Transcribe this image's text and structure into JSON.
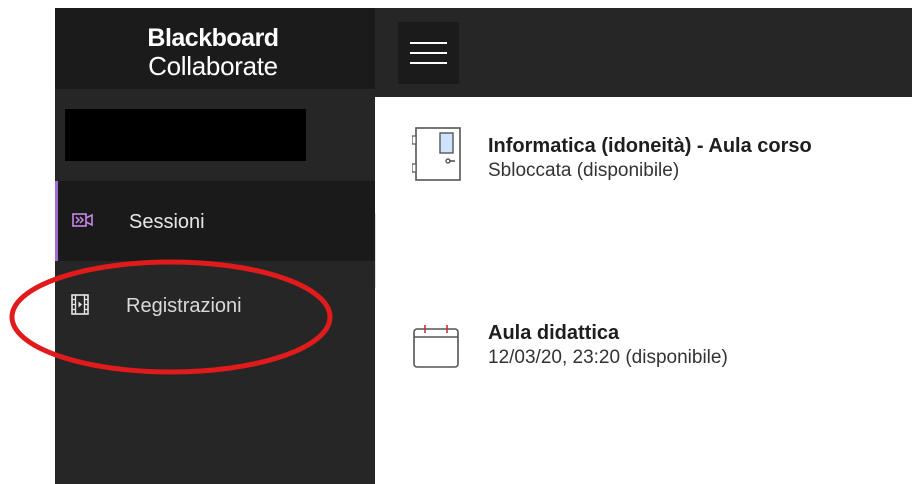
{
  "brand": {
    "line1": "Blackboard",
    "line2": "Collaborate"
  },
  "sidebar": {
    "items": [
      {
        "label": "Sessioni",
        "icon": "video-sessions-icon",
        "active": true
      },
      {
        "label": "Registrazioni",
        "icon": "film-recordings-icon",
        "active": false
      }
    ]
  },
  "header": {
    "menu_icon": "hamburger-menu-icon"
  },
  "sessions": [
    {
      "title": "Informatica (idoneità) - Aula corso",
      "status": "Sbloccata (disponibile)",
      "icon": "door-icon"
    },
    {
      "title": "Aula didattica",
      "status": "12/03/20, 23:20 (disponibile)",
      "icon": "calendar-icon"
    }
  ],
  "colors": {
    "sidebar": "#262626",
    "accent": "#a46bd1",
    "annotation": "#e11b1b"
  }
}
